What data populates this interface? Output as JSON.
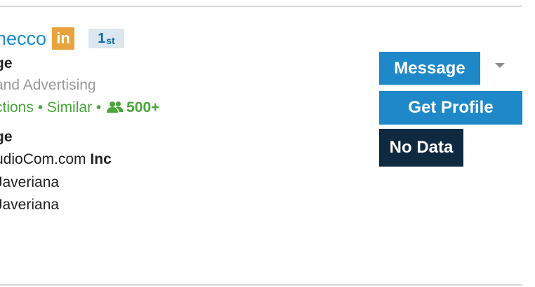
{
  "profile": {
    "name_fragment": "necco",
    "linkedin_badge": "in",
    "degree": "1",
    "degree_suffix": "st",
    "headline_fragment": "ge",
    "industry_fragment": "and Advertising",
    "connections": {
      "connections_fragment": "ctions",
      "separator1": " • ",
      "similar_label": "Similar",
      "separator2": " • ",
      "count": "500+"
    },
    "section2_title_fragment": "ge",
    "company_fragment": "udioCom.com",
    "company_suffix": "Inc",
    "school1_fragment": "Javeriana",
    "school2_fragment": "Javeriana"
  },
  "actions": {
    "message_label": "Message",
    "get_profile_label": "Get Profile",
    "no_data_label": "No Data"
  },
  "colors": {
    "link_blue": "#1a8ccf",
    "button_blue": "#1e88c9",
    "badge_orange": "#e8a33c",
    "green": "#4aa53a",
    "no_data_bg": "#0f2940"
  }
}
